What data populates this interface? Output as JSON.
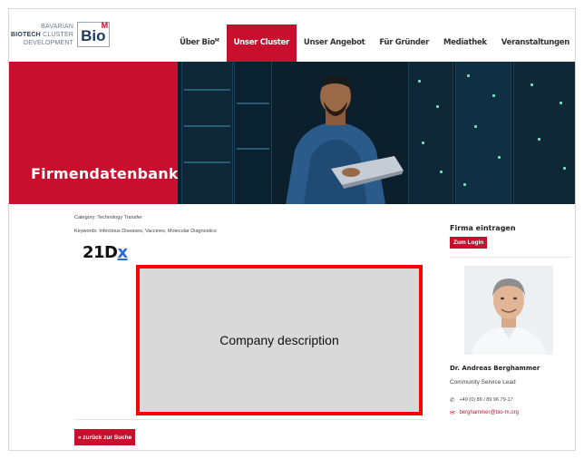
{
  "logo": {
    "line1": "BAVARIAN",
    "line2a": "BIOTECH",
    "line2b": "CLUSTER",
    "line3": "DEVELOPMENT",
    "mark": "Bio",
    "mark_sup": "M"
  },
  "nav": {
    "items": [
      {
        "label": "Über Bio",
        "sup": "M"
      },
      {
        "label": "Unser Cluster"
      },
      {
        "label": "Unser Angebot"
      },
      {
        "label": "Für Gründer"
      },
      {
        "label": "Mediathek"
      },
      {
        "label": "Veranstaltungen"
      }
    ],
    "active_index": 1
  },
  "hero": {
    "title": "Firmendatenbank"
  },
  "company": {
    "category": "Category: Technology Transfer",
    "keywords": "Keywords: Infectious Diseases, Vaccines, Molecular Diagnostics",
    "brand_text": "21D",
    "brand_x": "x",
    "description_placeholder": "Company description"
  },
  "back_button": "« zurück zur Suche",
  "sidebar": {
    "title": "Firma eintragen",
    "login_button": "Zum Login",
    "contact_name": "Dr. Andreas Berghammer",
    "contact_role": "Community Service Lead",
    "phone": "+49 (0) 89 / 89 96 79-17",
    "email": "berghammer@bio-m.org",
    "phone_icon": "phone-icon",
    "email_icon": "mail-icon"
  },
  "colors": {
    "accent": "#c8102e",
    "placeholder_border": "#ff0000",
    "placeholder_fill": "#d9d9d9"
  }
}
